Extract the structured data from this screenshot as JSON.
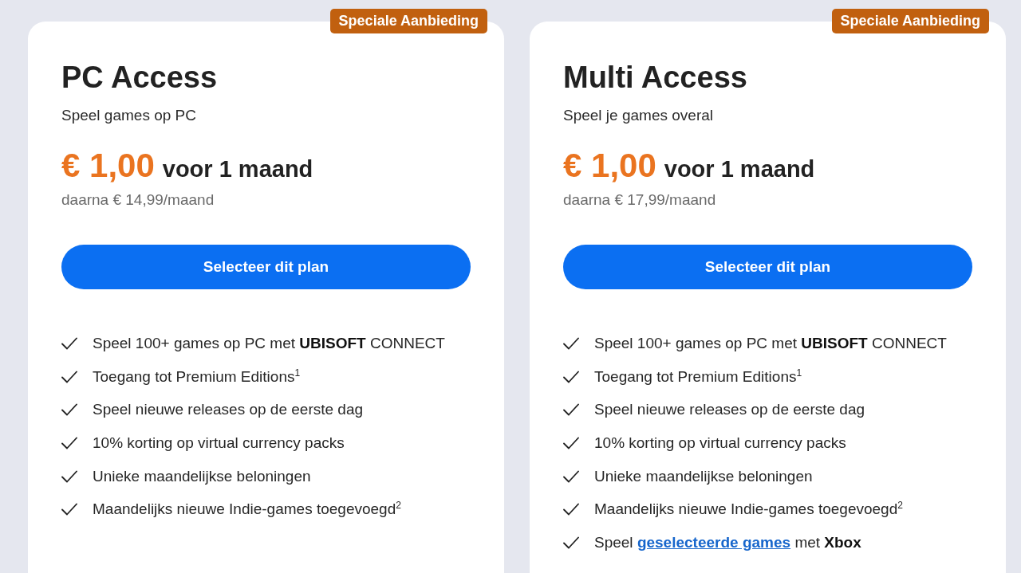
{
  "plans": [
    {
      "badge": "Speciale Aanbieding",
      "name": "PC Access",
      "tagline": "Speel games op PC",
      "price": "€ 1,00",
      "period": "voor 1 maand",
      "after_price": "daarna € 14,99/maand",
      "button": "Selecteer dit plan",
      "features": [
        {
          "text": "Speel 100+ games op PC met **UBISOFT** CONNECT"
        },
        {
          "text": "Toegang tot Premium Editions$^{1}$"
        },
        {
          "text": "Speel nieuwe releases op de eerste dag"
        },
        {
          "text": "10% korting op virtual currency packs"
        },
        {
          "text": "Unieke maandelijkse beloningen"
        },
        {
          "text": "Maandelijks nieuwe Indie-games toegevoegd$^{2}$"
        }
      ]
    },
    {
      "badge": "Speciale Aanbieding",
      "name": "Multi Access",
      "tagline": "Speel je games overal",
      "price": "€ 1,00",
      "period": "voor 1 maand",
      "after_price": "daarna € 17,99/maand",
      "button": "Selecteer dit plan",
      "features": [
        {
          "text": "Speel 100+ games op PC met **UBISOFT** CONNECT"
        },
        {
          "text": "Toegang tot Premium Editions$^{1}$"
        },
        {
          "text": "Speel nieuwe releases op de eerste dag"
        },
        {
          "text": "10% korting op virtual currency packs"
        },
        {
          "text": "Unieke maandelijkse beloningen"
        },
        {
          "text": "Maandelijks nieuwe Indie-games toegevoegd$^{2}$"
        },
        {
          "text": "Speel ",
          "link": "geselecteerde games",
          "text_after": " met **Xbox**"
        }
      ]
    }
  ]
}
